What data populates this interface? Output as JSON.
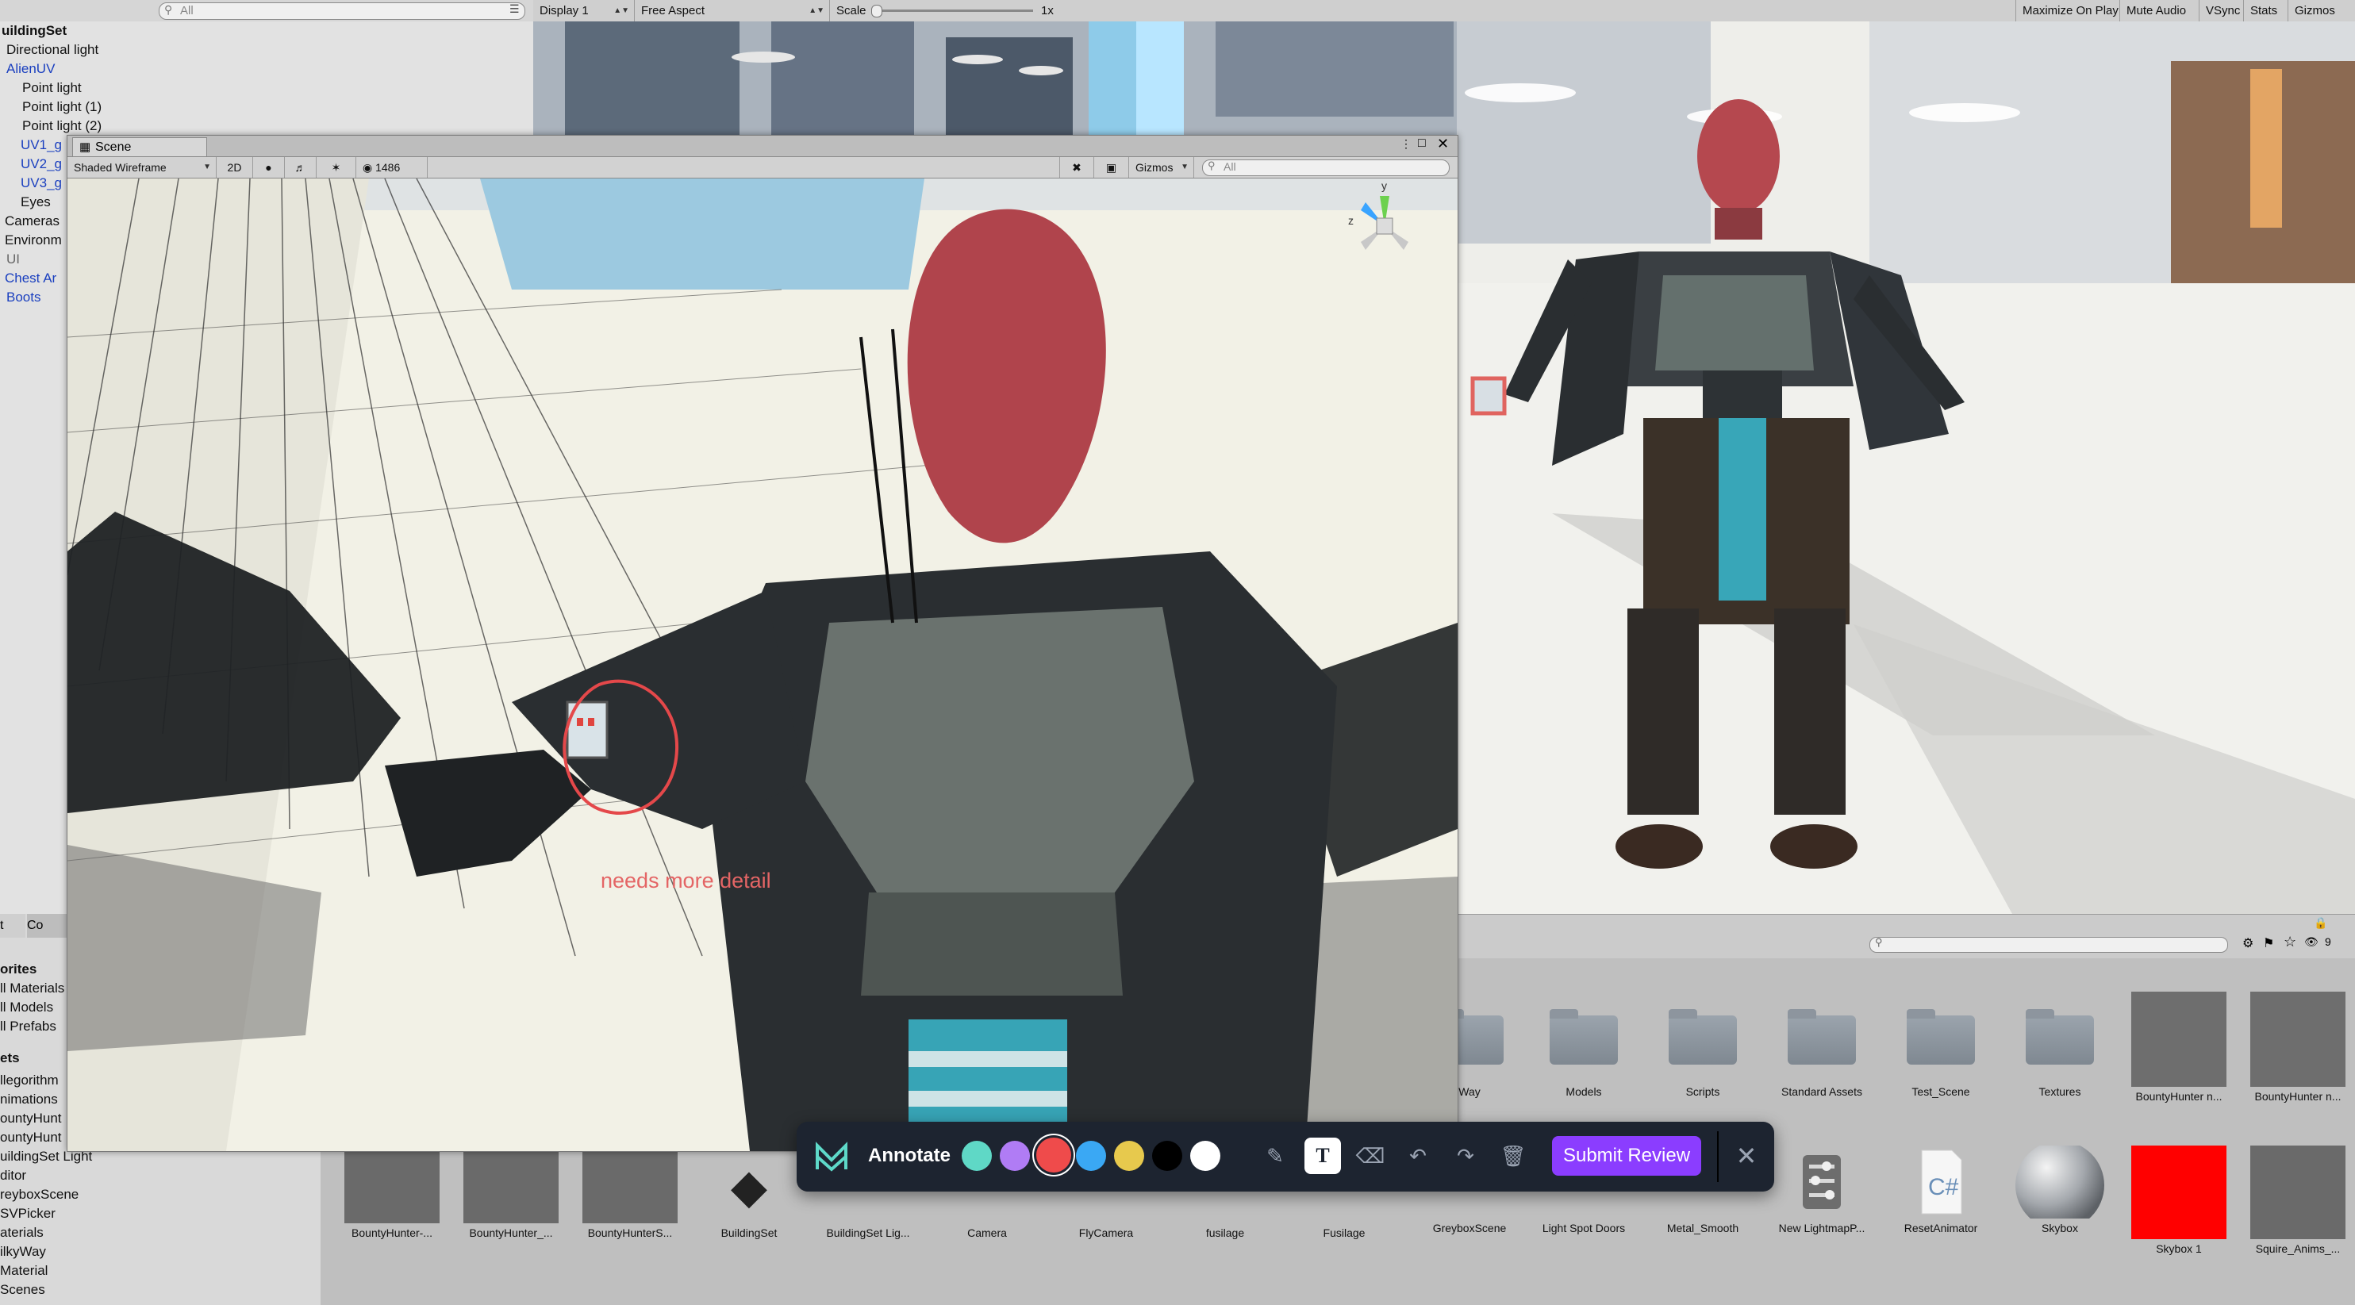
{
  "hierarchy": {
    "search_placeholder": "All",
    "scene_name": "uildingSet",
    "items": [
      {
        "label": "Directional light"
      },
      {
        "label": "AlienUV"
      },
      {
        "label": "Point light"
      },
      {
        "label": "Point light (1)"
      },
      {
        "label": "Point light (2)"
      },
      {
        "label": "UV1_g"
      },
      {
        "label": "UV2_g"
      },
      {
        "label": "UV3_g"
      },
      {
        "label": "Eyes"
      },
      {
        "label": "Cameras"
      },
      {
        "label": "Environm"
      },
      {
        "label": "UI"
      },
      {
        "label": "Chest Ar"
      },
      {
        "label": "Boots"
      }
    ]
  },
  "game_toolbar": {
    "display": "Display 1",
    "aspect": "Free Aspect",
    "scale_label": "Scale",
    "scale_value": "1x",
    "maximize": "Maximize On Play",
    "mute": "Mute Audio",
    "vsync": "VSync",
    "stats": "Stats",
    "gizmos": "Gizmos"
  },
  "scene_window": {
    "tab_label": "Scene",
    "shading_mode": "Shaded Wireframe",
    "mode_2d": "2D",
    "count": "1486",
    "gizmos": "Gizmos",
    "search_placeholder": "All",
    "axis_y": "y",
    "axis_z": "z"
  },
  "annotation": {
    "text": "needs more detail"
  },
  "annotate_bar": {
    "title": "Annotate",
    "submit_label": "Submit Review",
    "colors": [
      "#5fd8c6",
      "#b07cf5",
      "#ef4b4b",
      "#3aa8f4",
      "#e7c94d",
      "#000000",
      "#ffffff"
    ]
  },
  "project_left": {
    "tab1": "t",
    "tab2": "Co",
    "favorites_header": "orites",
    "favorites": [
      "ll Materials",
      "ll Models",
      "ll Prefabs"
    ],
    "assets_header": "ets",
    "folders": [
      "llegorithm",
      "nimations",
      "ountyHunt",
      "ountyHunt",
      "uildingSet Light",
      "ditor",
      "reyboxScene",
      "SVPicker",
      "aterials",
      "ilkyWay",
      "Material",
      "Scenes"
    ]
  },
  "project_assets_row1": [
    {
      "name": "Way"
    },
    {
      "name": "Models"
    },
    {
      "name": "Scripts"
    },
    {
      "name": "Standard Assets"
    },
    {
      "name": "Test_Scene"
    },
    {
      "name": "Textures"
    },
    {
      "name": "BountyHunter n..."
    },
    {
      "name": "BountyHunter n..."
    }
  ],
  "project_assets_row2": [
    {
      "name": "BountyHunter-..."
    },
    {
      "name": "BountyHunter_..."
    },
    {
      "name": "BountyHunterS..."
    },
    {
      "name": "BuildingSet"
    },
    {
      "name": "BuildingSet Lig..."
    },
    {
      "name": "Camera"
    },
    {
      "name": "FlyCamera"
    },
    {
      "name": "fusilage"
    },
    {
      "name": "Fusilage"
    },
    {
      "name": "GreyboxScene"
    },
    {
      "name": "Light Spot Doors"
    },
    {
      "name": "Metal_Smooth"
    },
    {
      "name": "New LightmapP..."
    },
    {
      "name": "ResetAnimator"
    },
    {
      "name": "Skybox"
    },
    {
      "name": "Skybox 1"
    },
    {
      "name": "Squire_Anims_..."
    }
  ],
  "project_toolbar": {
    "hidden_count": "9"
  }
}
